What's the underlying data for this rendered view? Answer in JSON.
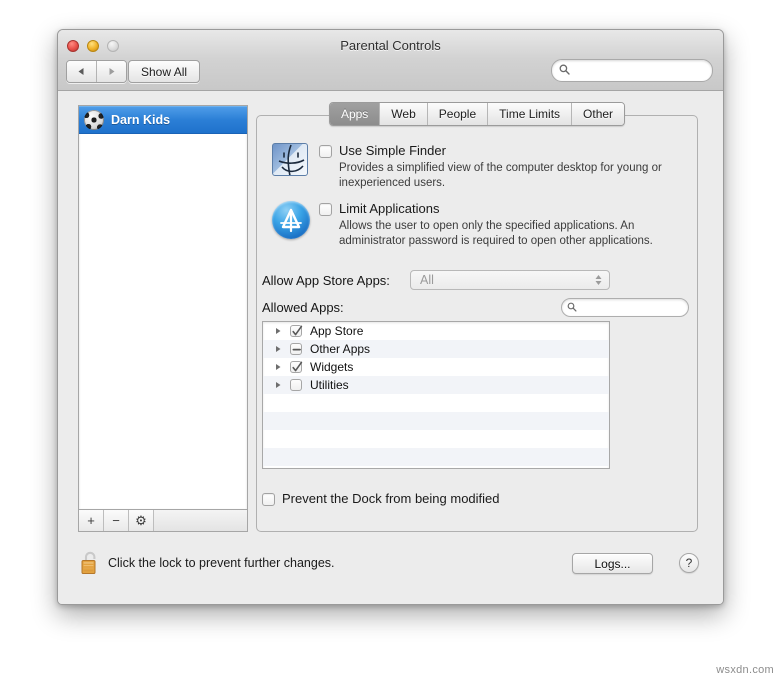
{
  "window": {
    "title": "Parental Controls",
    "traffic_lights": [
      "close-button",
      "minimize-button",
      "zoom-button"
    ],
    "back_icon": "back-triangle-icon",
    "forward_icon": "forward-triangle-icon",
    "show_all_label": "Show All",
    "search": {
      "value": "",
      "placeholder": "",
      "icon": "search-icon"
    }
  },
  "sidebar": {
    "users": [
      {
        "name": "Darn Kids",
        "avatar": "soccer-ball-avatar",
        "selected": true
      }
    ],
    "toolbar": {
      "add_label": "+",
      "remove_label": "−",
      "gear_label": "⚙"
    }
  },
  "tabs": [
    {
      "label": "Apps",
      "active": true
    },
    {
      "label": "Web",
      "active": false
    },
    {
      "label": "People",
      "active": false
    },
    {
      "label": "Time Limits",
      "active": false
    },
    {
      "label": "Other",
      "active": false
    }
  ],
  "apps_panel": {
    "simple_finder": {
      "icon": "finder-face-icon",
      "label": "Use Simple Finder",
      "checked": false,
      "description": "Provides a simplified view of the computer desktop for young or inexperienced users."
    },
    "limit_applications": {
      "icon": "app-store-icon",
      "label": "Limit Applications",
      "checked": false,
      "description": "Allows the user to open only the specified applications. An administrator password is required to open other applications."
    },
    "allow_store_apps": {
      "label": "Allow App Store Apps:",
      "value": "All",
      "options": [
        "All"
      ],
      "disabled": true
    },
    "allowed_apps": {
      "label": "Allowed Apps:",
      "search": {
        "value": "",
        "placeholder": "",
        "icon": "search-icon"
      },
      "rows": [
        {
          "name": "App Store",
          "state": "checked"
        },
        {
          "name": "Other Apps",
          "state": "mixed"
        },
        {
          "name": "Widgets",
          "state": "checked"
        },
        {
          "name": "Utilities",
          "state": "unchecked"
        }
      ],
      "empty_rows": 5
    },
    "prevent_dock": {
      "label": "Prevent the Dock from being modified",
      "checked": false
    }
  },
  "footer": {
    "lock_icon": "open-padlock-icon",
    "lock_text": "Click the lock to prevent further changes.",
    "logs_label": "Logs...",
    "help_label": "?"
  },
  "watermark": "wsxdn.com",
  "colors": {
    "selection_blue": "#2b7fd6",
    "window_chrome": "#ececec",
    "tab_active": "#909090",
    "lock_gold": "#e8a33d",
    "list_stripe": "#f2f4f8"
  }
}
